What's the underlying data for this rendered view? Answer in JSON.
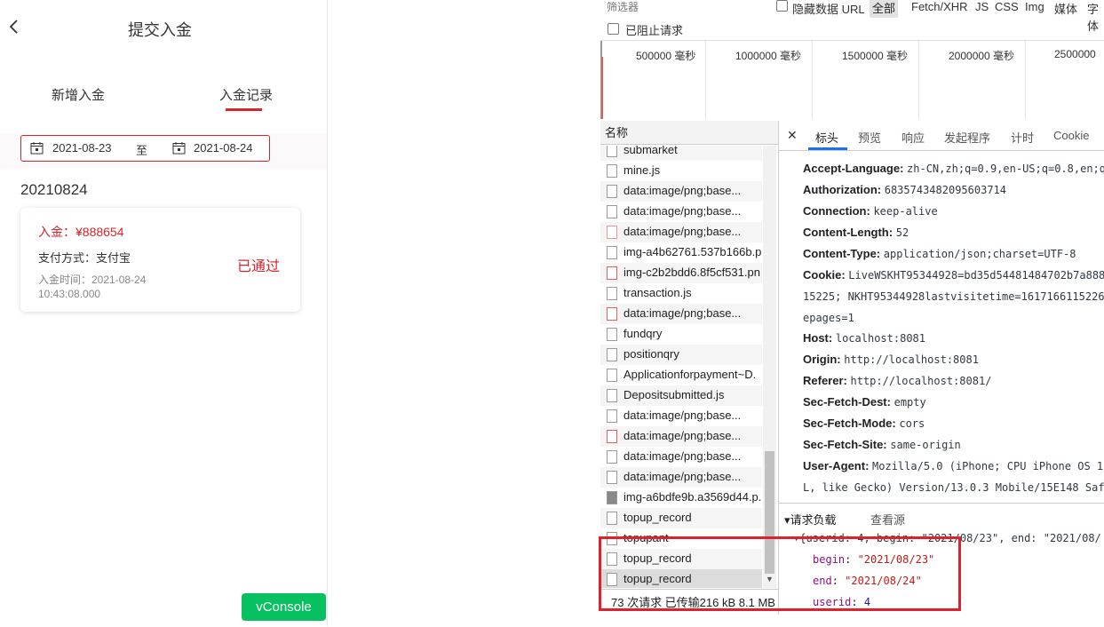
{
  "mobile": {
    "title": "提交入金",
    "tabs": [
      {
        "label": "新增入金"
      },
      {
        "label": "入金记录"
      }
    ],
    "date_filter": {
      "start": "2021-08-23",
      "separator": "至",
      "end": "2021-08-24"
    },
    "group_date": "20210824",
    "record": {
      "amount": "入金：¥888654",
      "payment_method": "支付方式：支付宝",
      "time": "入金时间：2021-08-24 10:43:08.000",
      "status": "已通过"
    },
    "vconsole_label": "vConsole",
    "accent_color": "#d9232d"
  },
  "devtools": {
    "filter_placeholder": "筛选器",
    "hide_data_url": "隐藏数据 URL",
    "types": [
      "全部",
      "Fetch/XHR",
      "JS",
      "CSS",
      "Img",
      "媒体",
      "字体"
    ],
    "blocked_requests": "已阻止请求",
    "timeline_ticks": [
      "500000  毫秒",
      "1000000  毫秒",
      "1500000  毫秒",
      "2000000  毫秒",
      "2500000"
    ],
    "name_header": "名称",
    "requests": [
      "submarket",
      "mine.js",
      "data:image/png;base...",
      "data:image/png;base...",
      "data:image/png;base...",
      "img-a4b62761.537b166b.p",
      "img-c2b2bdd6.8f5cf531.pn",
      "transaction.js",
      "data:image/png;base...",
      "fundqry",
      "positionqry",
      "Applicationforpayment~D.",
      "Depositsubmitted.js",
      "data:image/png;base...",
      "data:image/png;base...",
      "data:image/png;base...",
      "data:image/png;base...",
      "img-a6bdfe9b.a3569d44.p.",
      "topup_record",
      "topupant",
      "topup_record",
      "topup_record"
    ],
    "status_bar": "73 次请求  已传输216 kB  8.1 MB",
    "detail_tabs": [
      "标头",
      "预览",
      "响应",
      "发起程序",
      "计时",
      "Cookie"
    ],
    "headers": [
      {
        "name": "Accept-Language:",
        "value": "zh-CN,zh;q=0.9,en-US;q=0.8,en;q"
      },
      {
        "name": "Authorization:",
        "value": "6835743482095603714"
      },
      {
        "name": "Connection:",
        "value": "keep-alive"
      },
      {
        "name": "Content-Length:",
        "value": "52"
      },
      {
        "name": "Content-Type:",
        "value": "application/json;charset=UTF-8"
      },
      {
        "name": "Cookie:",
        "value": "LiveWSKHT95344928=bd35d54481484702b7a888"
      },
      {
        "name": "Host:",
        "value": "localhost:8081"
      },
      {
        "name": "Origin:",
        "value": "http://localhost:8081"
      },
      {
        "name": "Referer:",
        "value": "http://localhost:8081/"
      },
      {
        "name": "Sec-Fetch-Dest:",
        "value": "empty"
      },
      {
        "name": "Sec-Fetch-Mode:",
        "value": "cors"
      },
      {
        "name": "Sec-Fetch-Site:",
        "value": "same-origin"
      },
      {
        "name": "User-Agent:",
        "value": "Mozilla/5.0 (iPhone; CPU iPhone OS 1"
      }
    ],
    "cookie_cont": [
      "15225; NKHT95344928lastvisitetime=1617166115226",
      "epages=1"
    ],
    "ua_cont": "L, like Gecko) Version/13.0.3 Mobile/15E148 Saf",
    "payload_title": "▾请求负载",
    "view_source": "查看源",
    "payload_raw": "▾{userid: 4, begin: \"2021/08/23\", end: \"2021/08/",
    "payload_fields": [
      {
        "key": "begin",
        "value": "\"2021/08/23\""
      },
      {
        "key": "end",
        "value": "\"2021/08/24\""
      },
      {
        "key": "userid",
        "value": "4"
      }
    ]
  }
}
